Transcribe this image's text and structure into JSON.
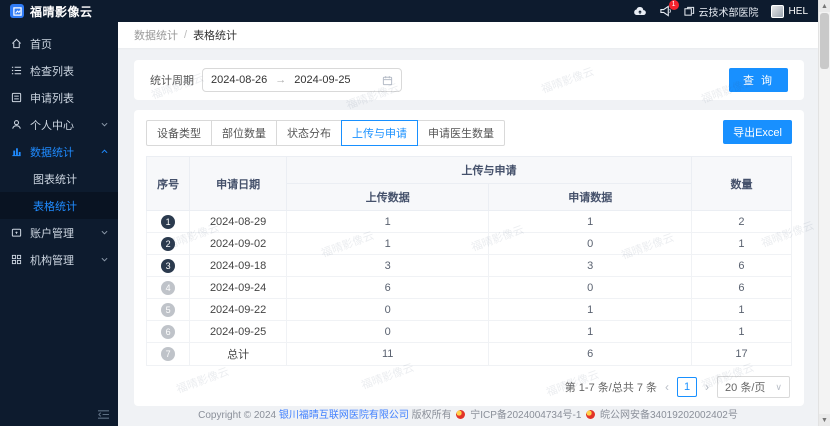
{
  "app": {
    "title": "福晴影像云"
  },
  "topbar": {
    "notification_count": "1",
    "org_name": "云技术部医院",
    "user_name": "HEL"
  },
  "sidebar": {
    "items": [
      {
        "label": "首页"
      },
      {
        "label": "检查列表"
      },
      {
        "label": "申请列表"
      },
      {
        "label": "个人中心"
      },
      {
        "label": "数据统计"
      },
      {
        "label": "图表统计"
      },
      {
        "label": "表格统计"
      },
      {
        "label": "账户管理"
      },
      {
        "label": "机构管理"
      }
    ]
  },
  "breadcrumb": {
    "parent": "数据统计",
    "current": "表格统计"
  },
  "filter": {
    "label": "统计周期",
    "start_date": "2024-08-26",
    "separator": "→",
    "end_date": "2024-09-25",
    "search_button": "查 询"
  },
  "tabs": [
    {
      "label": "设备类型"
    },
    {
      "label": "部位数量"
    },
    {
      "label": "状态分布"
    },
    {
      "label": "上传与申请"
    },
    {
      "label": "申请医生数量"
    }
  ],
  "export_button": "导出Excel",
  "table": {
    "headers": {
      "no": "序号",
      "date": "申请日期",
      "group": "上传与申请",
      "upload": "上传数据",
      "apply": "申请数据",
      "count": "数量"
    },
    "rows": [
      {
        "no": "1",
        "date": "2024-08-29",
        "upload": "1",
        "apply": "1",
        "count": "2"
      },
      {
        "no": "2",
        "date": "2024-09-02",
        "upload": "1",
        "apply": "0",
        "count": "1"
      },
      {
        "no": "3",
        "date": "2024-09-18",
        "upload": "3",
        "apply": "3",
        "count": "6"
      },
      {
        "no": "4",
        "date": "2024-09-24",
        "upload": "6",
        "apply": "0",
        "count": "6"
      },
      {
        "no": "5",
        "date": "2024-09-22",
        "upload": "0",
        "apply": "1",
        "count": "1"
      },
      {
        "no": "6",
        "date": "2024-09-25",
        "upload": "0",
        "apply": "1",
        "count": "1"
      },
      {
        "no": "7",
        "date": "总计",
        "upload": "11",
        "apply": "6",
        "count": "17"
      }
    ]
  },
  "pagination": {
    "total_text": "第 1-7 条/总共 7 条",
    "prev": "‹",
    "page": "1",
    "next": "›",
    "page_size": "20 条/页"
  },
  "footer": {
    "copyright_prefix": "Copyright © 2024",
    "company": "银川福晴互联网医院有限公司",
    "rights": "版权所有",
    "icp": "宁ICP备2024004734号-1",
    "police": "皖公网安备34019202002402号"
  },
  "watermark": {
    "text": "福晴影像云"
  },
  "colors": {
    "accent": "#1890ff",
    "sidebar_bg": "#0d1b2e",
    "badge_red": "#f5222d"
  }
}
